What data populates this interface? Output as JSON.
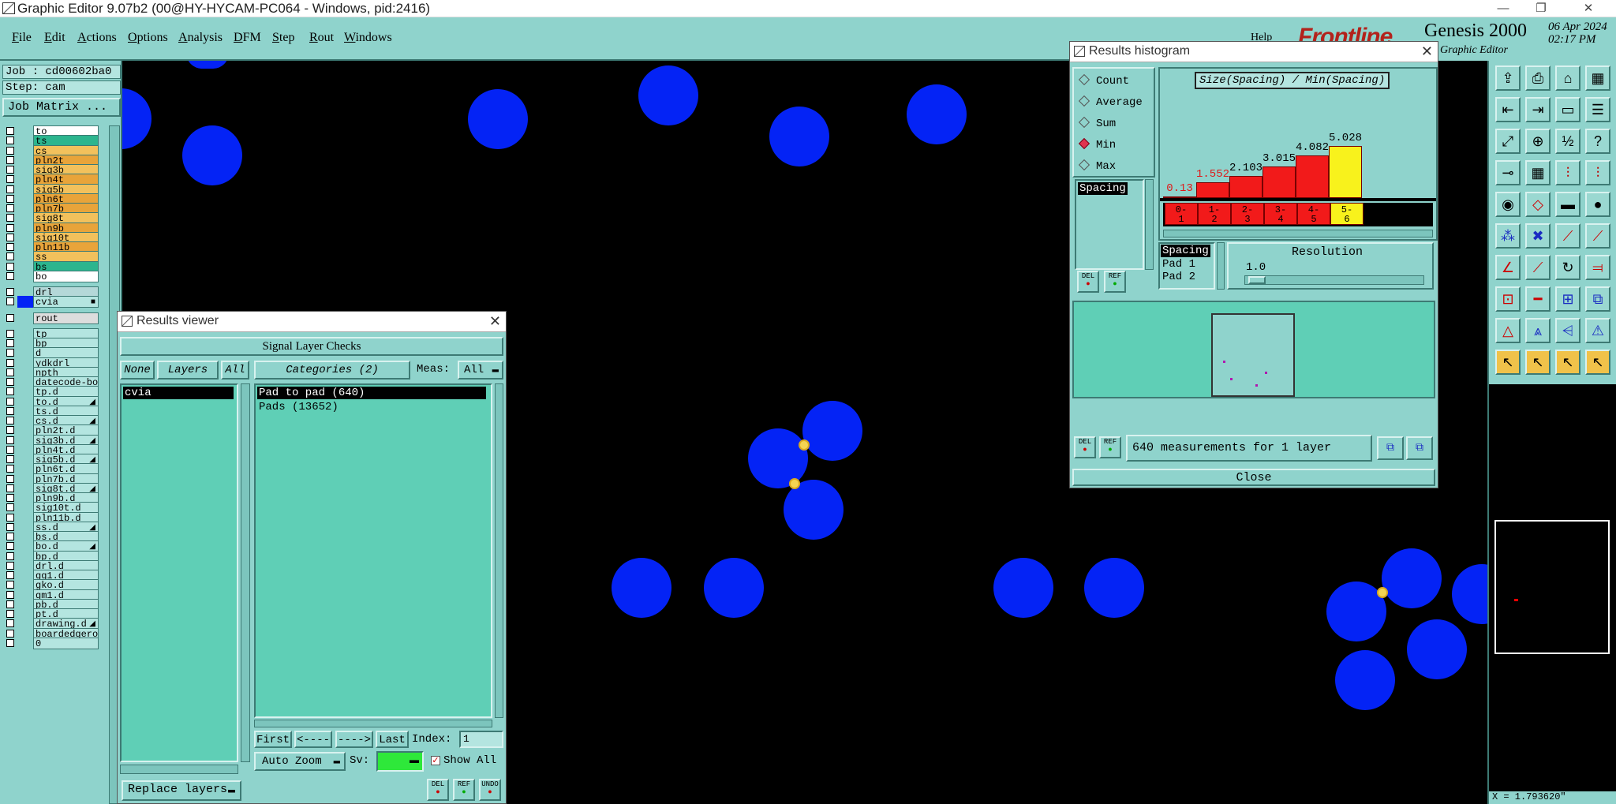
{
  "titlebar": {
    "title": "Graphic Editor 9.07b2 (00@HY-HYCAM-PC064 - Windows, pid:2416)",
    "min": "—",
    "max": "❐",
    "close": "✕"
  },
  "menu": [
    "File",
    "Edit",
    "Actions",
    "Options",
    "Analysis",
    "DFM",
    "Step",
    "Rout",
    "Windows"
  ],
  "help": "Help",
  "brand": {
    "logo": "Frontline",
    "product": "Genesis 2000",
    "subtitle": "Graphic Editor",
    "date": "06 Apr 2024",
    "time": "02:17 PM"
  },
  "job": {
    "job": "Job : cd00602ba0",
    "step": "Step: cam",
    "matrix": "Job Matrix ..."
  },
  "layers": [
    {
      "name": "to",
      "color": "#ffffff"
    },
    {
      "name": "ts",
      "color": "#2cb58e"
    },
    {
      "name": "cs",
      "color": "#f2c15c"
    },
    {
      "name": "pln2t",
      "color": "#e8a43a"
    },
    {
      "name": "sig3b",
      "color": "#f2c15c"
    },
    {
      "name": "pln4t",
      "color": "#e8a43a"
    },
    {
      "name": "sig5b",
      "color": "#f2c15c"
    },
    {
      "name": "pln6t",
      "color": "#e8a43a"
    },
    {
      "name": "pln7b",
      "color": "#e8a43a"
    },
    {
      "name": "sig8t",
      "color": "#f2c15c"
    },
    {
      "name": "pln9b",
      "color": "#e8a43a"
    },
    {
      "name": "sig10t",
      "color": "#f2c15c"
    },
    {
      "name": "pln11b",
      "color": "#e8a43a"
    },
    {
      "name": "ss",
      "color": "#f2c15c"
    },
    {
      "name": "bs",
      "color": "#2cb58e"
    },
    {
      "name": "bo",
      "color": "#ffffff"
    },
    {
      "name": "",
      "color": ""
    },
    {
      "name": "drl",
      "color": "#b4d8d8"
    },
    {
      "name": "cvia",
      "color": "#b4e5e0",
      "active": true
    },
    {
      "name": "",
      "color": ""
    },
    {
      "name": "rout",
      "color": "#dddddd"
    },
    {
      "name": "",
      "color": ""
    },
    {
      "name": "tp",
      "color": "#b4e5e0"
    },
    {
      "name": "bp",
      "color": "#b4e5e0"
    },
    {
      "name": "d",
      "color": "#b4e5e0"
    },
    {
      "name": "ydkdrl",
      "color": "#b4e5e0"
    },
    {
      "name": "npth",
      "color": "#b4e5e0"
    },
    {
      "name": "datecode-bo",
      "color": "#b4e5e0"
    },
    {
      "name": "tp.d",
      "color": "#b4e5e0"
    },
    {
      "name": "to.d",
      "color": "#b4e5e0",
      "mark": true
    },
    {
      "name": "ts.d",
      "color": "#b4e5e0"
    },
    {
      "name": "cs.d",
      "color": "#b4e5e0",
      "mark": true
    },
    {
      "name": "pln2t.d",
      "color": "#b4e5e0"
    },
    {
      "name": "sig3b.d",
      "color": "#b4e5e0",
      "mark": true
    },
    {
      "name": "pln4t.d",
      "color": "#b4e5e0"
    },
    {
      "name": "sig5b.d",
      "color": "#b4e5e0",
      "mark": true
    },
    {
      "name": "pln6t.d",
      "color": "#b4e5e0"
    },
    {
      "name": "pln7b.d",
      "color": "#b4e5e0"
    },
    {
      "name": "sig8t.d",
      "color": "#b4e5e0",
      "mark": true
    },
    {
      "name": "pln9b.d",
      "color": "#b4e5e0"
    },
    {
      "name": "sig10t.d",
      "color": "#b4e5e0"
    },
    {
      "name": "pln11b.d",
      "color": "#b4e5e0"
    },
    {
      "name": "ss.d",
      "color": "#b4e5e0",
      "mark": true
    },
    {
      "name": "bs.d",
      "color": "#b4e5e0"
    },
    {
      "name": "bo.d",
      "color": "#b4e5e0",
      "mark": true
    },
    {
      "name": "bp.d",
      "color": "#b4e5e0"
    },
    {
      "name": "drl.d",
      "color": "#b4e5e0"
    },
    {
      "name": "gg1.d",
      "color": "#b4e5e0"
    },
    {
      "name": "gko.d",
      "color": "#b4e5e0"
    },
    {
      "name": "gm1.d",
      "color": "#b4e5e0"
    },
    {
      "name": "pb.d",
      "color": "#b4e5e0"
    },
    {
      "name": "pt.d",
      "color": "#b4e5e0"
    },
    {
      "name": "drawing.d",
      "color": "#b4e5e0",
      "mark": true
    },
    {
      "name": "boardedgero",
      "color": "#b4e5e0"
    },
    {
      "name": "0",
      "color": "#b4e5e0"
    }
  ],
  "viewer": {
    "title": "Results viewer",
    "header": "Signal Layer Checks",
    "none": "None",
    "layers": "Layers",
    "all": "All",
    "categories": "Categories (2)",
    "meas_label": "Meas:",
    "meas_value": "All",
    "layer_items": [
      "cvia"
    ],
    "category_items": [
      "Pad to pad (640)",
      "Pads (13652)"
    ],
    "first": "First",
    "prev": "<----",
    "next": "---->",
    "last": "Last",
    "index_label": "Index:",
    "index_value": "1",
    "zoom": "Auto Zoom",
    "sv": "Sv:",
    "show_all": "Show All",
    "replace": "Replace layers",
    "del": "DEL",
    "ref": "REF",
    "undo": "UNDO"
  },
  "histogram": {
    "title": "Results histogram",
    "options": [
      {
        "label": "Count",
        "on": false
      },
      {
        "label": "Average",
        "on": false
      },
      {
        "label": "Sum",
        "on": false
      },
      {
        "label": "Min",
        "on": true
      },
      {
        "label": "Max",
        "on": false
      }
    ],
    "heading": "Size(Spacing) / Min(Spacing)",
    "layer_item": "Spacing",
    "attrs": [
      "Spacing",
      "Pad 1",
      "Pad 2"
    ],
    "resolution_label": "Resolution",
    "resolution_value": "1.0",
    "summary": "640 measurements for 1 layer",
    "close": "Close",
    "del": "DEL",
    "ref": "REF"
  },
  "chart_data": {
    "type": "bar",
    "title": "Size(Spacing) / Min(Spacing)",
    "categories": [
      "0-1",
      "1-2",
      "2-3",
      "3-4",
      "4-5",
      "5-6"
    ],
    "values": [
      0.13,
      1.552,
      2.103,
      3.015,
      4.082,
      5.028
    ],
    "highlighted": "5-6",
    "colors": {
      "bar": "#f21a1a",
      "highlight": "#f8f21c"
    }
  },
  "coord": "X = 1.793620\""
}
